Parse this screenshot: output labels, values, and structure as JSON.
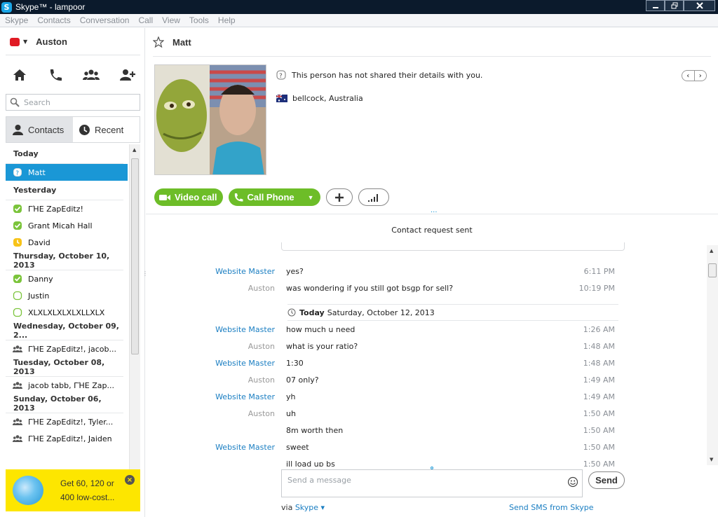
{
  "window": {
    "title": "Skype™ - lampoor",
    "app_icon": "S"
  },
  "menu": [
    "Skype",
    "Contacts",
    "Conversation",
    "Call",
    "View",
    "Tools",
    "Help"
  ],
  "profile": {
    "name": "Auston",
    "status_color": "#e01b24"
  },
  "nav_icons": [
    "home-icon",
    "phone-icon",
    "group-icon",
    "add-contact-icon"
  ],
  "search": {
    "placeholder": "Search"
  },
  "tabs": {
    "contacts": "Contacts",
    "recent": "Recent"
  },
  "recent": [
    {
      "group": "Today",
      "items": [
        {
          "name": "Matt",
          "status": "offline-question",
          "selected": true
        }
      ]
    },
    {
      "group": "Yesterday",
      "items": [
        {
          "name": "ΓΉΕ ZapEditz!",
          "status": "online"
        },
        {
          "name": "Grant Micah Hall",
          "status": "online"
        },
        {
          "name": "David",
          "status": "away"
        }
      ]
    },
    {
      "group": "Thursday, October 10, 2013",
      "items": [
        {
          "name": "Danny",
          "status": "online"
        },
        {
          "name": "Justin",
          "status": "offline"
        },
        {
          "name": "XLXLXLXLXLXLLXLX",
          "status": "offline"
        }
      ]
    },
    {
      "group": "Wednesday, October 09, 2...",
      "items": [
        {
          "name": "ΓΉΕ ZapEditz!, jacob...",
          "status": "group"
        }
      ]
    },
    {
      "group": "Tuesday, October 08, 2013",
      "items": [
        {
          "name": "jacob tabb, ΓΉΕ Zap...",
          "status": "group"
        }
      ]
    },
    {
      "group": "Sunday, October 06, 2013",
      "items": [
        {
          "name": "ΓΉΕ ZapEditz!, Tyler...",
          "status": "group"
        },
        {
          "name": "ΓΉΕ ZapEditz!, Jaiden",
          "status": "group"
        }
      ]
    }
  ],
  "promo": {
    "text": "Get 60, 120 or 400 low-cost...",
    "close": "×"
  },
  "chat": {
    "name": "Matt",
    "info": "This person has not shared their details with you.",
    "location": "bellcock, Australia",
    "video_call": "Video call",
    "call_phone": "Call Phone",
    "more_dots": "...",
    "request_sent": "Contact request sent",
    "date_header_bold": "Today",
    "date_header_rest": "Saturday, October 12, 2013",
    "messages_before": [
      {
        "who": "Website Master",
        "ext": true,
        "text": "yes?",
        "time": "6:11 PM"
      },
      {
        "who": "Auston",
        "ext": false,
        "text": "was wondering if you still got bsgp for sell?",
        "time": "10:19 PM"
      }
    ],
    "messages_after": [
      {
        "who": "Website Master",
        "ext": true,
        "text": "how much u need",
        "time": "1:26 AM"
      },
      {
        "who": "Auston",
        "ext": false,
        "text": "what is your ratio?",
        "time": "1:48 AM"
      },
      {
        "who": "Website Master",
        "ext": true,
        "text": "1:30",
        "time": "1:48 AM"
      },
      {
        "who": "Auston",
        "ext": false,
        "text": "07 only?",
        "time": "1:49 AM"
      },
      {
        "who": "Website Master",
        "ext": true,
        "text": "yh",
        "time": "1:49 AM"
      },
      {
        "who": "Auston",
        "ext": false,
        "text": "uh",
        "time": "1:50 AM"
      },
      {
        "who": "",
        "ext": false,
        "text": "8m worth then",
        "time": "1:50 AM"
      },
      {
        "who": "Website Master",
        "ext": true,
        "text": "sweet",
        "time": "1:50 AM"
      },
      {
        "who": "",
        "ext": true,
        "text": "ill load up bs",
        "time": "1:50 AM"
      }
    ],
    "compose_placeholder": "Send a message",
    "send": "Send",
    "via_label": "via",
    "via_link": "Skype",
    "sms_link": "Send SMS from Skype"
  },
  "colors": {
    "accent": "#1a97d6",
    "green": "#6dbd28",
    "promo": "#fde600",
    "link": "#1a7ec2"
  }
}
